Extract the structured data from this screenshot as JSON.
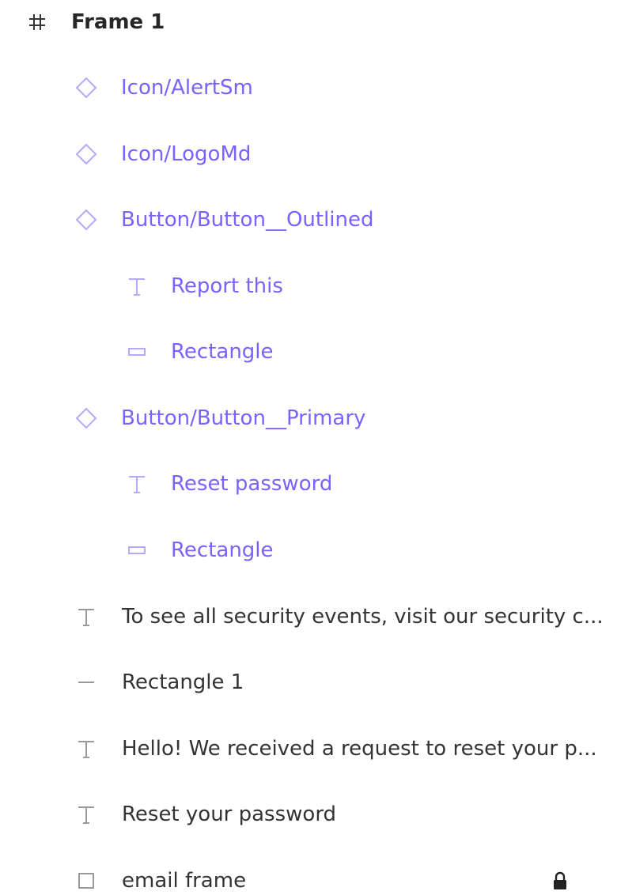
{
  "layers": {
    "frame": {
      "label": "Frame 1",
      "icon": "frame-hash-icon"
    },
    "items": [
      {
        "label": "Icon/AlertSm",
        "icon": "component-instance-icon",
        "kind": "component"
      },
      {
        "label": "Icon/LogoMd",
        "icon": "component-instance-icon",
        "kind": "component"
      },
      {
        "label": "Button/Button__Outlined",
        "icon": "component-instance-icon",
        "kind": "component"
      },
      {
        "label": "Report this",
        "icon": "text-icon",
        "kind": "component-child"
      },
      {
        "label": "Rectangle",
        "icon": "rectangle-icon",
        "kind": "component-child"
      },
      {
        "label": "Button/Button__Primary",
        "icon": "component-instance-icon",
        "kind": "component"
      },
      {
        "label": "Reset password",
        "icon": "text-icon",
        "kind": "component-child"
      },
      {
        "label": "Rectangle",
        "icon": "rectangle-icon",
        "kind": "component-child"
      },
      {
        "label": "To see all security events, visit our security c...",
        "icon": "text-icon",
        "kind": "layer"
      },
      {
        "label": "Rectangle 1",
        "icon": "line-icon",
        "kind": "layer"
      },
      {
        "label": "Hello! We received a request to reset your p...",
        "icon": "text-icon",
        "kind": "layer"
      },
      {
        "label": "Reset your password",
        "icon": "text-icon",
        "kind": "layer"
      },
      {
        "label": "email frame",
        "icon": "frame-square-icon",
        "kind": "layer",
        "locked": true,
        "lock_icon": "lock-icon"
      }
    ]
  },
  "colors": {
    "component": "#7b61ff",
    "component_icon": "#b7a8ff",
    "text": "#333333",
    "icon_gray": "#9a9a9a"
  }
}
